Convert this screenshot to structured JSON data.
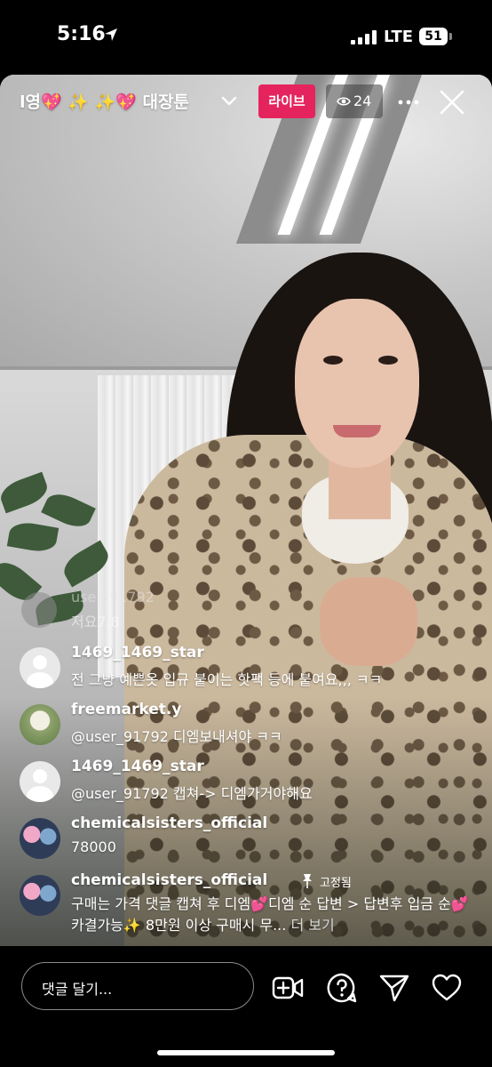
{
  "status_bar": {
    "time": "5:16",
    "carrier": "LTE",
    "battery": "51"
  },
  "live_header": {
    "title": "l영💖 ✨  ✨💖 대장툰",
    "live_label": "라이브",
    "viewer_count": "24"
  },
  "comments": {
    "faded": {
      "username": "user_91792",
      "text": "저요7.8"
    },
    "items": [
      {
        "username": "1469_1469_star",
        "text": "전 그냥 예쁜옷 입규 붙이는 핫팩 등에 붙여요,,, ㅋㅋ"
      },
      {
        "username": "freemarket.y",
        "text": "@user_91792 디엠보내셔야 ㅋㅋ"
      },
      {
        "username": "1469_1469_star",
        "text": "@user_91792 캡쳐-> 디엠가거야해요"
      },
      {
        "username": "chemicalsisters_official",
        "text": "78000"
      }
    ],
    "pinned": {
      "username": "chemicalsisters_official",
      "pinned_label": "고정됨",
      "text": "구매는 가격 댓글 캡쳐 후 디엠💕디엠 순 답변 > 답변후 입금 순💕 카결가능✨ 8만원 이상 구매시 무...",
      "see_more": "더 보기"
    }
  },
  "footer": {
    "comment_placeholder": "댓글 달기..."
  },
  "colors": {
    "live_badge": "#e5245e",
    "background": "#000000"
  }
}
